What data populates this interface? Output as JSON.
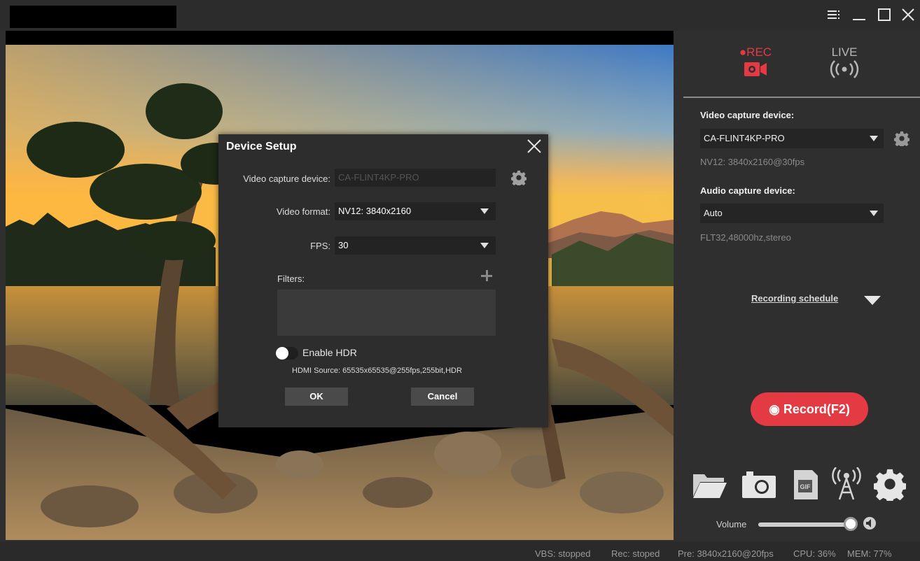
{
  "window": {
    "title": "",
    "controls": [
      "menu-icon",
      "minimize-icon",
      "maximize-icon",
      "close-icon"
    ]
  },
  "modes": {
    "rec_label": "●REC",
    "live_label": "LIVE",
    "rec_color": "#e43a44"
  },
  "panel": {
    "video_device_label": "Video capture device:",
    "video_device_value": "CA-FLINT4KP-PRO",
    "video_info": "NV12: 3840x2160@30fps",
    "audio_device_label": "Audio capture device:",
    "audio_device_value": "Auto",
    "audio_info": "FLT32,48000hz,stereo",
    "recording_schedule": "Recording schedule",
    "record_button": "◉ Record(F2)",
    "volume_label": "Volume",
    "volume_level": 1.0
  },
  "tools": [
    "folder-icon",
    "camera-icon",
    "gif-icon",
    "broadcast-icon",
    "settings-icon"
  ],
  "dialog": {
    "title": "Device Setup",
    "video_device_label": "Video capture device:",
    "video_device_value": "CA-FLINT4KP-PRO",
    "video_format_label": "Video format:",
    "video_format_value": "NV12: 3840x2160",
    "fps_label": "FPS:",
    "fps_value": "30",
    "filters_label": "Filters:",
    "hdr_label": "Enable HDR",
    "hdr_enabled": false,
    "hdmi_source": "HDMI Source: 65535x65535@255fps,255bit,HDR",
    "ok_label": "OK",
    "cancel_label": "Cancel"
  },
  "status": {
    "vbs": "VBS: stopped",
    "rec": "Rec: stoped",
    "pre": "Pre: 3840x2160@20fps",
    "cpu": "CPU: 36%",
    "mem": "MEM: 77%"
  }
}
